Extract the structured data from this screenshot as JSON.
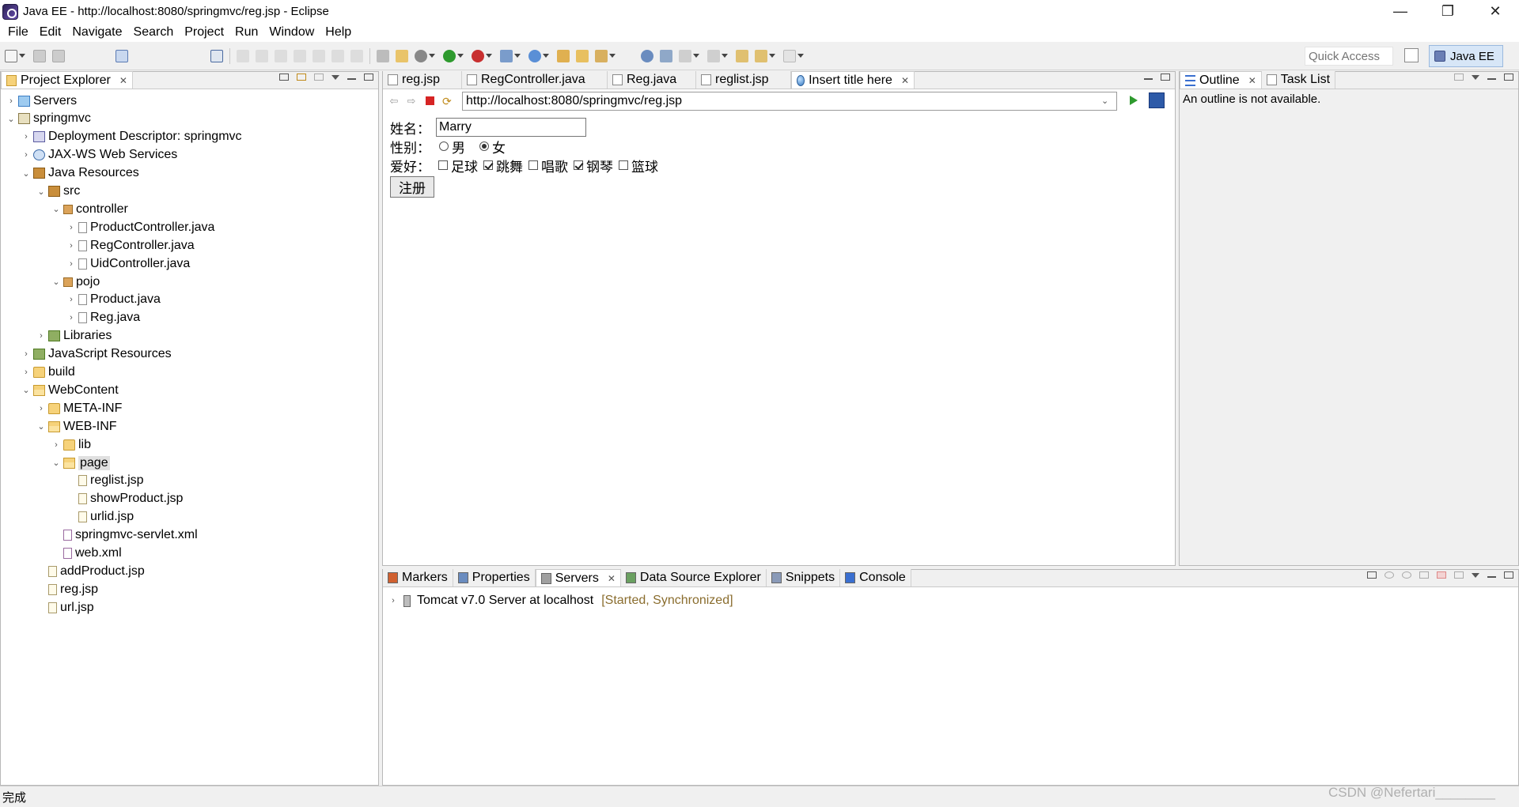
{
  "window": {
    "title": "Java EE - http://localhost:8080/springmvc/reg.jsp - Eclipse",
    "minimize": "—",
    "restore": "❐",
    "close": "✕"
  },
  "menu": [
    "File",
    "Edit",
    "Navigate",
    "Search",
    "Project",
    "Run",
    "Window",
    "Help"
  ],
  "toolbar": {
    "quick_access_placeholder": "Quick Access",
    "perspective": "Java EE"
  },
  "project_explorer": {
    "tab": "Project Explorer",
    "tree": [
      {
        "label": "Servers",
        "level": 0,
        "tw": "›",
        "icon": "servers"
      },
      {
        "label": "springmvc",
        "level": 0,
        "tw": "⌄",
        "icon": "project"
      },
      {
        "label": "Deployment Descriptor: springmvc",
        "level": 1,
        "tw": "›",
        "icon": "deploy"
      },
      {
        "label": "JAX-WS Web Services",
        "level": 1,
        "tw": "›",
        "icon": "ws"
      },
      {
        "label": "Java Resources",
        "level": 1,
        "tw": "⌄",
        "icon": "src"
      },
      {
        "label": "src",
        "level": 2,
        "tw": "⌄",
        "icon": "src"
      },
      {
        "label": "controller",
        "level": 3,
        "tw": "⌄",
        "icon": "package"
      },
      {
        "label": "ProductController.java",
        "level": 4,
        "tw": "›",
        "icon": "java"
      },
      {
        "label": "RegController.java",
        "level": 4,
        "tw": "›",
        "icon": "java"
      },
      {
        "label": "UidController.java",
        "level": 4,
        "tw": "›",
        "icon": "java"
      },
      {
        "label": "pojo",
        "level": 3,
        "tw": "⌄",
        "icon": "package"
      },
      {
        "label": "Product.java",
        "level": 4,
        "tw": "›",
        "icon": "java"
      },
      {
        "label": "Reg.java",
        "level": 4,
        "tw": "›",
        "icon": "java"
      },
      {
        "label": "Libraries",
        "level": 2,
        "tw": "›",
        "icon": "lib"
      },
      {
        "label": "JavaScript Resources",
        "level": 1,
        "tw": "›",
        "icon": "lib"
      },
      {
        "label": "build",
        "level": 1,
        "tw": "›",
        "icon": "folder"
      },
      {
        "label": "WebContent",
        "level": 1,
        "tw": "⌄",
        "icon": "folder-open"
      },
      {
        "label": "META-INF",
        "level": 2,
        "tw": "›",
        "icon": "folder"
      },
      {
        "label": "WEB-INF",
        "level": 2,
        "tw": "⌄",
        "icon": "folder-open"
      },
      {
        "label": "lib",
        "level": 3,
        "tw": "›",
        "icon": "folder"
      },
      {
        "label": "page",
        "level": 3,
        "tw": "⌄",
        "icon": "folder-open",
        "selected": true
      },
      {
        "label": "reglist.jsp",
        "level": 4,
        "tw": "",
        "icon": "jsp"
      },
      {
        "label": "showProduct.jsp",
        "level": 4,
        "tw": "",
        "icon": "jsp"
      },
      {
        "label": "urlid.jsp",
        "level": 4,
        "tw": "",
        "icon": "jsp"
      },
      {
        "label": "springmvc-servlet.xml",
        "level": 3,
        "tw": "",
        "icon": "xml"
      },
      {
        "label": "web.xml",
        "level": 3,
        "tw": "",
        "icon": "xml"
      },
      {
        "label": "addProduct.jsp",
        "level": 2,
        "tw": "",
        "icon": "jsp"
      },
      {
        "label": "reg.jsp",
        "level": 2,
        "tw": "",
        "icon": "jsp"
      },
      {
        "label": "url.jsp",
        "level": 2,
        "tw": "",
        "icon": "jsp"
      }
    ]
  },
  "editor": {
    "tabs": [
      {
        "label": "reg.jsp",
        "icon": "jsp"
      },
      {
        "label": "RegController.java",
        "icon": "java"
      },
      {
        "label": "Reg.java",
        "icon": "java"
      },
      {
        "label": "reglist.jsp",
        "icon": "jsp"
      },
      {
        "label": "Insert title here",
        "icon": "globe",
        "active": true
      }
    ],
    "url": "http://localhost:8080/springmvc/reg.jsp",
    "form": {
      "name_label": "姓名：",
      "name_value": "Marry",
      "gender_label": "性别：",
      "gender_male": "男",
      "gender_female": "女",
      "gender_selected": "女",
      "hobby_label": "爱好：",
      "hobbies": [
        {
          "label": "足球",
          "checked": false
        },
        {
          "label": "跳舞",
          "checked": true
        },
        {
          "label": "唱歌",
          "checked": false
        },
        {
          "label": "钢琴",
          "checked": true
        },
        {
          "label": "篮球",
          "checked": false
        }
      ],
      "submit": "注册"
    }
  },
  "outline": {
    "tabs": [
      "Outline",
      "Task List"
    ],
    "message": "An outline is not available."
  },
  "bottom": {
    "tabs": [
      "Markers",
      "Properties",
      "Servers",
      "Data Source Explorer",
      "Snippets",
      "Console"
    ],
    "active_tab": "Servers",
    "server_name": "Tomcat v7.0 Server at localhost",
    "server_status": "[Started, Synchronized]"
  },
  "status_bar": "完成",
  "watermark": "CSDN @Nefertari________"
}
